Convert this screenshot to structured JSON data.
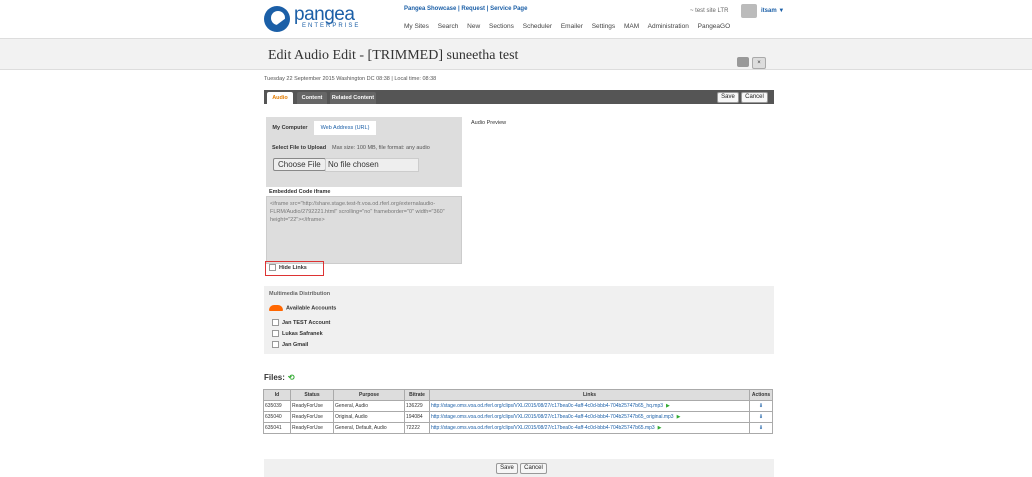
{
  "header": {
    "logo_text": "pangea",
    "logo_sub": "ENTERPRISE",
    "top_links": [
      "Pangea Showcase",
      "Request",
      "Service Page"
    ],
    "nav": [
      "My Sites",
      "Search",
      "New",
      "Sections",
      "Scheduler",
      "Emailer",
      "Settings",
      "MAM",
      "Administration",
      "PangeaGO"
    ],
    "site_info": "~ test site LTR",
    "user": "itsam ▼"
  },
  "page": {
    "title": "Edit Audio Edit - [TRIMMED] suneetha test",
    "date_line": "Tuesday 22 September 2015 Washington DC 08:38 | Local time: 08:38"
  },
  "tabs": [
    "Audio",
    "Content",
    "Related Content"
  ],
  "buttons": {
    "save": "Save",
    "cancel": "Cancel"
  },
  "upload": {
    "tab_computer": "My Computer",
    "tab_web": "Web Address (URL)",
    "select_label": "Select File to Upload",
    "max_size": "Max size: 100 MB, file format: any audio",
    "choose_btn": "Choose File",
    "no_file": "No file chosen",
    "audio_preview": "Audio Preview"
  },
  "embed": {
    "label": "Embedded Code iframe",
    "code": "<iframe src=\"http://share.stage.test-fr.voa.od.rferl.org/externalaudio-FLRM/Audio/2792221.html\" scrolling=\"no\" frameborder=\"0\" width=\"360\" height=\"22\"></iframe>"
  },
  "hide_links": "Hide Links",
  "distribution": {
    "title": "Multimedia Distribution",
    "available": "Available Accounts",
    "accounts": [
      "Jan TEST Account",
      "Lukas Safranek",
      "Jan Gmail"
    ]
  },
  "files": {
    "title": "Files:",
    "headers": [
      "Id",
      "Status",
      "Purpose",
      "Bitrate",
      "Links",
      "Actions"
    ],
    "rows": [
      {
        "id": "635039",
        "status": "ReadyForUse",
        "purpose": "General, Audio",
        "bitrate": "136229",
        "link": "http://stage.oms.voa.od.rferl.org/clips/VXL/2015/08/27/c17bea0c-4aff-4c0d-bbb4-704b25747b65_hq.mp3"
      },
      {
        "id": "635040",
        "status": "ReadyForUse",
        "purpose": "Original, Audio",
        "bitrate": "194084",
        "link": "http://stage.oms.voa.od.rferl.org/clips/VXL/2015/08/27/c17bea0c-4aff-4c0d-bbb4-704b25747b65_original.mp3"
      },
      {
        "id": "635041",
        "status": "ReadyForUse",
        "purpose": "General, Default, Audio",
        "bitrate": "72222",
        "link": "http://stage.oms.voa.od.rferl.org/clips/VXL/2015/08/27/c17bea0c-4aff-4c0d-bbb4-704b25747b65.mp3"
      }
    ]
  }
}
